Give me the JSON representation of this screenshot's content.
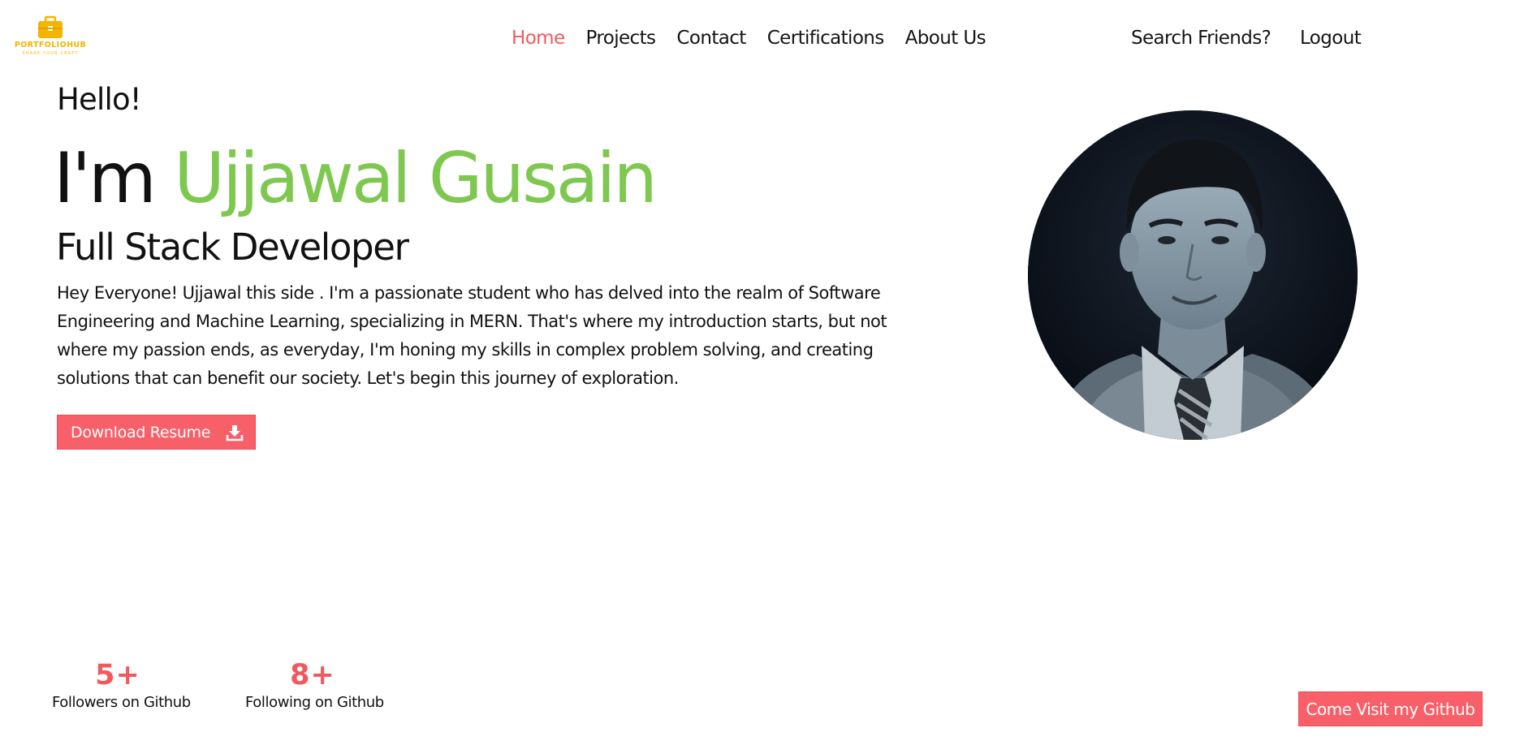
{
  "brand": {
    "name": "PORTFOLIOHUB",
    "tagline": "SHARE YOUR CRAFT",
    "color": "#f4b400",
    "icon": "briefcase-icon"
  },
  "nav": {
    "links": [
      {
        "label": "Home",
        "active": true
      },
      {
        "label": "Projects",
        "active": false
      },
      {
        "label": "Contact",
        "active": false
      },
      {
        "label": "Certifications",
        "active": false
      },
      {
        "label": "About Us",
        "active": false
      }
    ],
    "search_label": "Search Friends?",
    "logout_label": "Logout",
    "active_color": "#f05a5f"
  },
  "hero": {
    "greeting": "Hello!",
    "intro_prefix": "I'm",
    "name": "Ujjawal Gusain",
    "name_color": "#7ec850",
    "role": "Full Stack Developer",
    "bio": "Hey Everyone! Ujjawal this side . I'm a passionate student who has delved into the realm of Software Engineering and Machine Learning, specializing in MERN. That's where my introduction starts, but not where my passion ends, as everyday, I'm honing my skills in complex problem solving, and creating solutions that can benefit our society. Let's begin this journey of exploration.",
    "resume_button": "Download Resume",
    "resume_icon": "download-icon",
    "avatar": "profile-photo"
  },
  "stats": [
    {
      "value": "5+",
      "label": "Followers on Github"
    },
    {
      "value": "8+",
      "label": "Following on Github"
    }
  ],
  "github_button": "Come Visit my Github",
  "accent_color": "#f76068"
}
